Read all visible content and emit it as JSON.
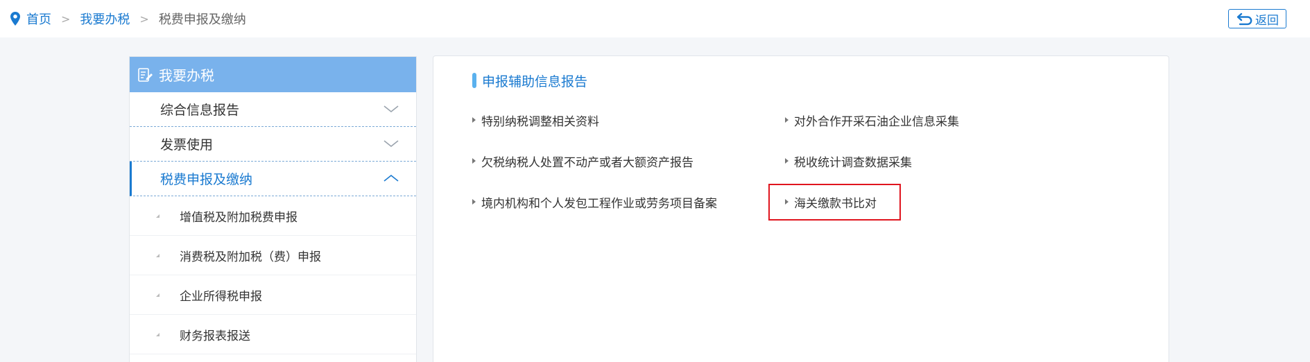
{
  "breadcrumb": {
    "icon": "location-pin-icon",
    "home": "首页",
    "level2": "我要办税",
    "current": "税费申报及缴纳",
    "separator": ">"
  },
  "back_button": {
    "label": "返回",
    "icon": "return-arrow-icon"
  },
  "sidebar": {
    "header": {
      "title": "我要办税",
      "icon": "edit-document-icon"
    },
    "groups": [
      {
        "label": "综合信息报告",
        "state": "collapsed",
        "icon": "chevron-down-icon"
      },
      {
        "label": "发票使用",
        "state": "collapsed",
        "icon": "chevron-down-icon"
      },
      {
        "label": "税费申报及缴纳",
        "state": "expanded",
        "icon": "chevron-up-icon"
      }
    ],
    "sub_items": [
      {
        "label": "增值税及附加税费申报"
      },
      {
        "label": "消费税及附加税（费）申报"
      },
      {
        "label": "企业所得税申报"
      },
      {
        "label": "财务报表报送"
      }
    ]
  },
  "main": {
    "section_title": "申报辅助信息报告",
    "items": [
      {
        "label": "特别纳税调整相关资料"
      },
      {
        "label": "对外合作开采石油企业信息采集"
      },
      {
        "label": "欠税纳税人处置不动产或者大额资产报告"
      },
      {
        "label": "税收统计调查数据采集"
      },
      {
        "label": "境内机构和个人发包工程作业或劳务项目备案"
      },
      {
        "label": "海关缴款书比对",
        "highlighted": true
      }
    ]
  },
  "colors": {
    "accent": "#1a7ad0",
    "sidebar_header": "#79b2ec",
    "highlight_border": "#e0141e",
    "background": "#f4f6f9"
  }
}
